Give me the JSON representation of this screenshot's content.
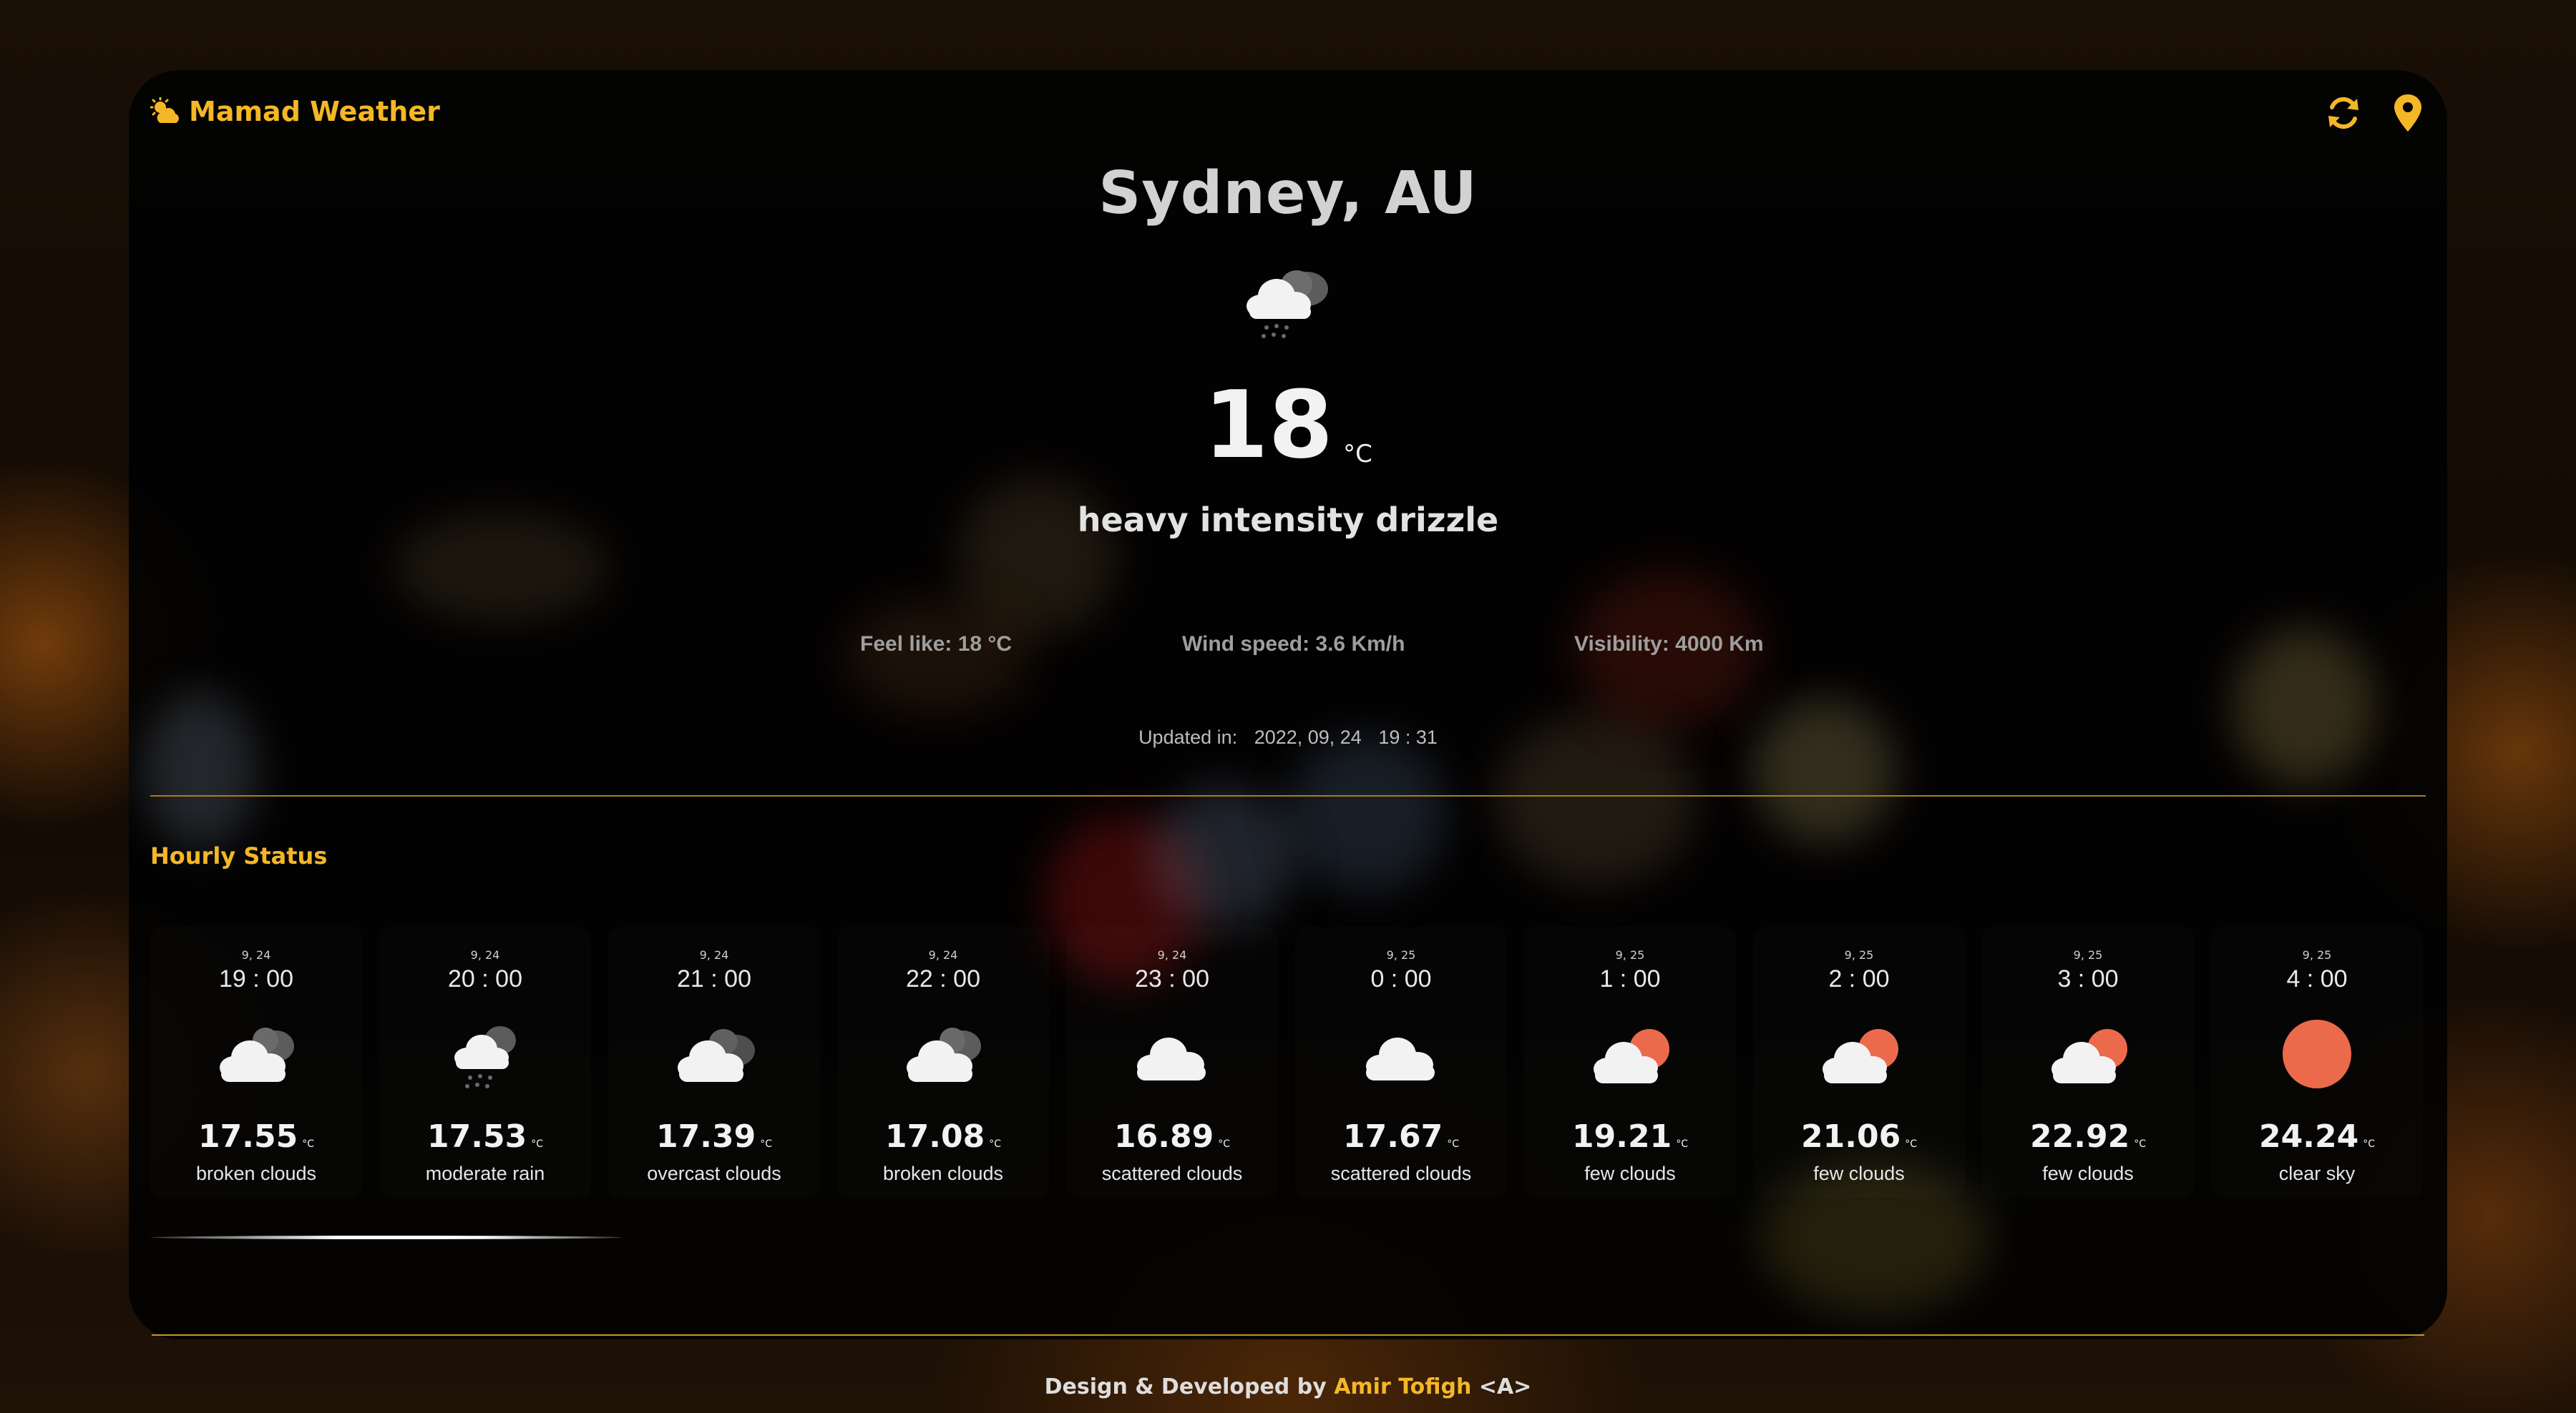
{
  "brand": {
    "name": "Mamad Weather",
    "icon": "sun-cloud-icon"
  },
  "header": {
    "refresh_icon": "refresh-icon",
    "location_icon": "location-pin-icon"
  },
  "current": {
    "city": "Sydney, AU",
    "icon": "cloud-drizzle-icon",
    "temperature": "18",
    "unit": "°C",
    "description": "heavy intensity drizzle",
    "feel_like": "Feel like: 18 °C",
    "wind_speed": "Wind speed: 3.6 Km/h",
    "visibility": "Visibility: 4000 Km",
    "updated_label": "Updated in:",
    "updated_date": "2022, 09, 24",
    "updated_time": "19 : 31"
  },
  "hourly": {
    "title": "Hourly Status",
    "items": [
      {
        "date": "9, 24",
        "time": "19 : 00",
        "icon": "broken-clouds-icon",
        "temp": "17.55",
        "unit": "°C",
        "desc": "broken clouds"
      },
      {
        "date": "9, 24",
        "time": "20 : 00",
        "icon": "rain-cloud-icon",
        "temp": "17.53",
        "unit": "°C",
        "desc": "moderate rain"
      },
      {
        "date": "9, 24",
        "time": "21 : 00",
        "icon": "overcast-clouds-icon",
        "temp": "17.39",
        "unit": "°C",
        "desc": "overcast clouds"
      },
      {
        "date": "9, 24",
        "time": "22 : 00",
        "icon": "broken-clouds-icon",
        "temp": "17.08",
        "unit": "°C",
        "desc": "broken clouds"
      },
      {
        "date": "9, 24",
        "time": "23 : 00",
        "icon": "scattered-clouds-icon",
        "temp": "16.89",
        "unit": "°C",
        "desc": "scattered clouds"
      },
      {
        "date": "9, 25",
        "time": "0 : 00",
        "icon": "scattered-clouds-icon",
        "temp": "17.67",
        "unit": "°C",
        "desc": "scattered clouds"
      },
      {
        "date": "9, 25",
        "time": "1 : 00",
        "icon": "few-clouds-icon",
        "temp": "19.21",
        "unit": "°C",
        "desc": "few clouds"
      },
      {
        "date": "9, 25",
        "time": "2 : 00",
        "icon": "few-clouds-icon",
        "temp": "21.06",
        "unit": "°C",
        "desc": "few clouds"
      },
      {
        "date": "9, 25",
        "time": "3 : 00",
        "icon": "few-clouds-icon",
        "temp": "22.92",
        "unit": "°C",
        "desc": "few clouds"
      },
      {
        "date": "9, 25",
        "time": "4 : 00",
        "icon": "clear-sky-icon",
        "temp": "24.24",
        "unit": "°C",
        "desc": "clear sky"
      }
    ]
  },
  "footer": {
    "prefix": "Design & Developed by",
    "author": "Amir Tofigh",
    "suffix": "<A>"
  },
  "colors": {
    "accent": "#f4b726",
    "sun": "#ec6a4c",
    "card_bg": "#020202"
  }
}
